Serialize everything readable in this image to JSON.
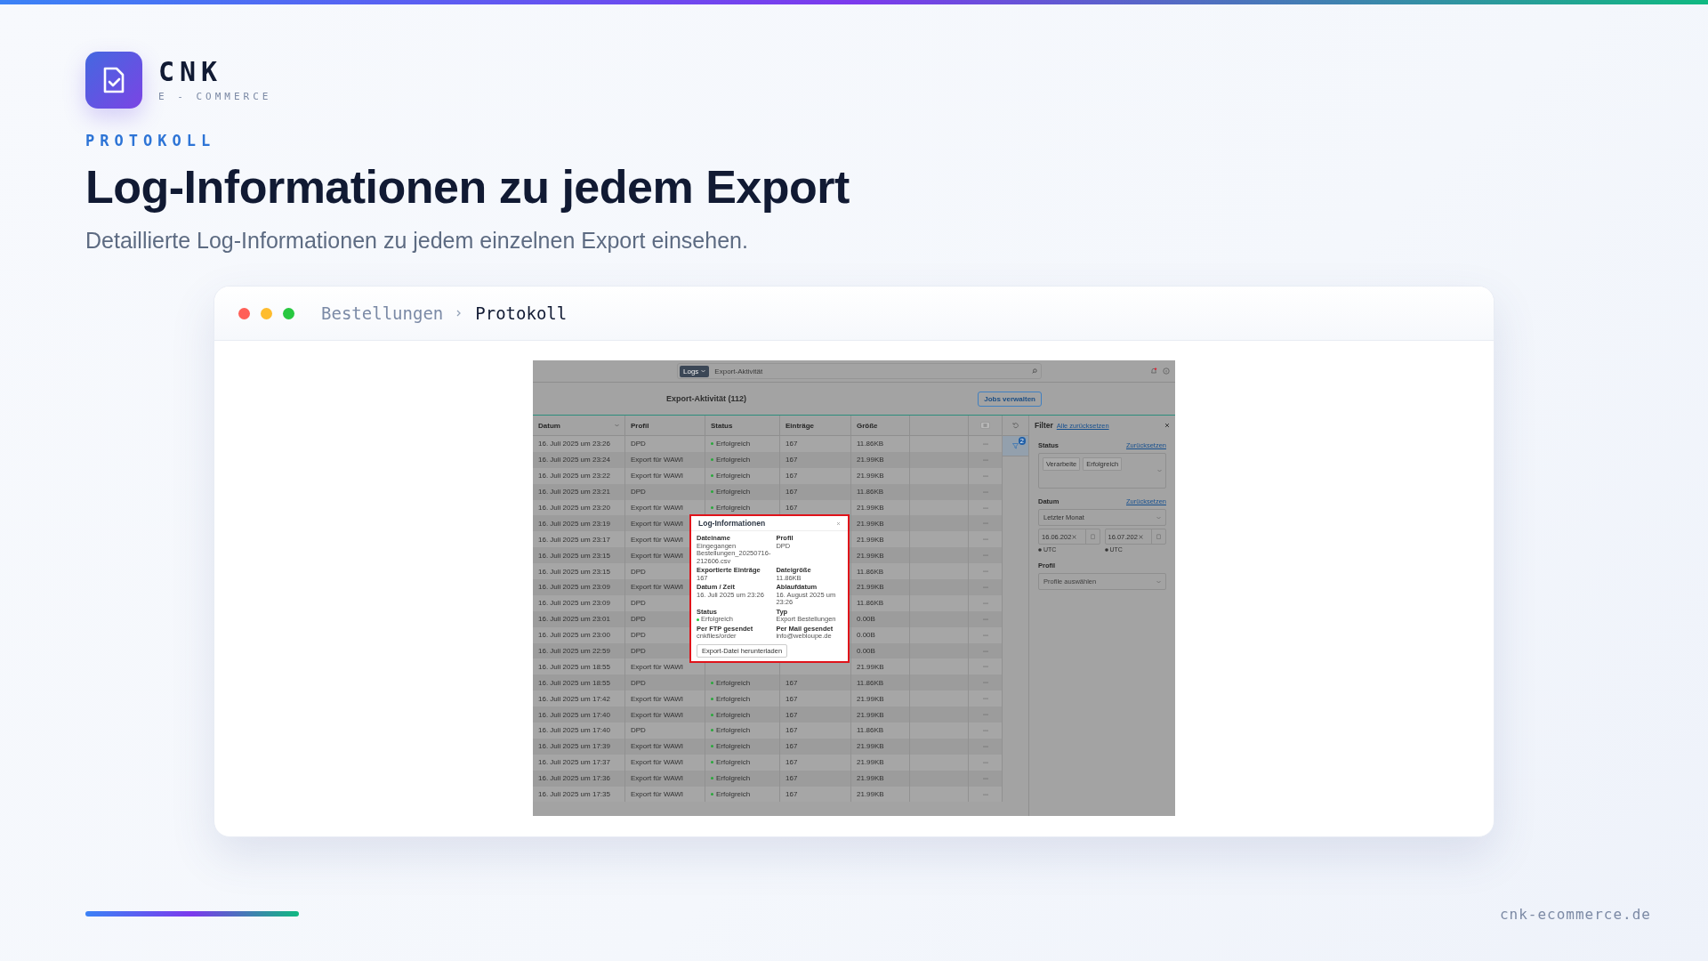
{
  "brand": {
    "name": "CNK",
    "tagline": "E - COMMERCE"
  },
  "eyebrow": "PROTOKOLL",
  "headline": "Log-Informationen zu jedem Export",
  "subtitle": "Detaillierte Log-Informationen zu jedem einzelnen Export einsehen.",
  "window": {
    "breadcrumb": [
      {
        "label": "Bestellungen",
        "current": false
      },
      {
        "label": "Protokoll",
        "current": true
      }
    ]
  },
  "app": {
    "menu_button": "Logs",
    "search_value": "Export-Aktivität",
    "title": "Export-Aktivität (112)",
    "action_button": "Jobs verwalten",
    "columns": [
      "Datum",
      "Profil",
      "Status",
      "Einträge",
      "Größe"
    ],
    "rows": [
      {
        "date": "16. Juli 2025 um 23:26",
        "profile": "DPD",
        "status": "Erfolgreich",
        "entries": "167",
        "size": "11.86KB"
      },
      {
        "date": "16. Juli 2025 um 23:24",
        "profile": "Export für WAWI",
        "status": "Erfolgreich",
        "entries": "167",
        "size": "21.99KB"
      },
      {
        "date": "16. Juli 2025 um 23:22",
        "profile": "Export für WAWI",
        "status": "Erfolgreich",
        "entries": "167",
        "size": "21.99KB"
      },
      {
        "date": "16. Juli 2025 um 23:21",
        "profile": "DPD",
        "status": "Erfolgreich",
        "entries": "167",
        "size": "11.86KB"
      },
      {
        "date": "16. Juli 2025 um 23:20",
        "profile": "Export für WAWI",
        "status": "Erfolgreich",
        "entries": "167",
        "size": "21.99KB"
      },
      {
        "date": "16. Juli 2025 um 23:19",
        "profile": "Export für WAWI",
        "size": "21.99KB"
      },
      {
        "date": "16. Juli 2025 um 23:17",
        "profile": "Export für WAWI",
        "size": "21.99KB"
      },
      {
        "date": "16. Juli 2025 um 23:15",
        "profile": "Export für WAWI",
        "size": "21.99KB"
      },
      {
        "date": "16. Juli 2025 um 23:15",
        "profile": "DPD",
        "size": "11.86KB"
      },
      {
        "date": "16. Juli 2025 um 23:09",
        "profile": "Export für WAWI",
        "size": "21.99KB"
      },
      {
        "date": "16. Juli 2025 um 23:09",
        "profile": "DPD",
        "size": "11.86KB"
      },
      {
        "date": "16. Juli 2025 um 23:01",
        "profile": "DPD",
        "size": "0.00B"
      },
      {
        "date": "16. Juli 2025 um 23:00",
        "profile": "DPD",
        "size": "0.00B"
      },
      {
        "date": "16. Juli 2025 um 22:59",
        "profile": "DPD",
        "size": "0.00B"
      },
      {
        "date": "16. Juli 2025 um 18:55",
        "profile": "Export für WAWI",
        "size": "21.99KB"
      },
      {
        "date": "16. Juli 2025 um 18:55",
        "profile": "DPD",
        "status": "Erfolgreich",
        "entries": "167",
        "size": "11.86KB"
      },
      {
        "date": "16. Juli 2025 um 17:42",
        "profile": "Export für WAWI",
        "status": "Erfolgreich",
        "entries": "167",
        "size": "21.99KB"
      },
      {
        "date": "16. Juli 2025 um 17:40",
        "profile": "Export für WAWI",
        "status": "Erfolgreich",
        "entries": "167",
        "size": "21.99KB"
      },
      {
        "date": "16. Juli 2025 um 17:40",
        "profile": "DPD",
        "status": "Erfolgreich",
        "entries": "167",
        "size": "11.86KB"
      },
      {
        "date": "16. Juli 2025 um 17:39",
        "profile": "Export für WAWI",
        "status": "Erfolgreich",
        "entries": "167",
        "size": "21.99KB"
      },
      {
        "date": "16. Juli 2025 um 17:37",
        "profile": "Export für WAWI",
        "status": "Erfolgreich",
        "entries": "167",
        "size": "21.99KB"
      },
      {
        "date": "16. Juli 2025 um 17:36",
        "profile": "Export für WAWI",
        "status": "Erfolgreich",
        "entries": "167",
        "size": "21.99KB"
      },
      {
        "date": "16. Juli 2025 um 17:35",
        "profile": "Export für WAWI",
        "status": "Erfolgreich",
        "entries": "167",
        "size": "21.99KB"
      }
    ],
    "filter_badge": "2",
    "filter": {
      "title": "Filter",
      "reset_all": "Alle zurücksetzen",
      "status": {
        "label": "Status",
        "reset": "Zurücksetzen",
        "chips": [
          "Verarbeite",
          "Erfolgreich"
        ]
      },
      "date": {
        "label": "Datum",
        "reset": "Zurücksetzen",
        "range": "Letzter Monat",
        "from": "16.06.202",
        "to": "16.07.202",
        "from_zone": "UTC",
        "to_zone": "UTC"
      },
      "profile": {
        "label": "Profil",
        "placeholder": "Profile auswählen"
      }
    },
    "modal": {
      "title": "Log-Informationen",
      "fields": [
        {
          "label": "Dateiname",
          "value": "Eingegangen Bestellungen_20250716-212606.csv"
        },
        {
          "label": "Profil",
          "value": "DPD"
        },
        {
          "label": "Exportierte Einträge",
          "value": "167"
        },
        {
          "label": "Dateigröße",
          "value": "11.86KB"
        },
        {
          "label": "Datum / Zeit",
          "value": "16. Juli 2025 um 23:26"
        },
        {
          "label": "Ablaufdatum",
          "value": "16. August 2025 um 23:26"
        },
        {
          "label": "Status",
          "value": "Erfolgreich",
          "kind": "status"
        },
        {
          "label": "Typ",
          "value": "Export Bestellungen"
        },
        {
          "label": "Per FTP gesendet",
          "value": "cnkfiles/order"
        },
        {
          "label": "Per Mail gesendet",
          "value": "info@webloupe.de"
        }
      ],
      "button": "Export-Datei herunterladen"
    }
  },
  "footer": {
    "url": "cnk-ecommerce.de"
  }
}
